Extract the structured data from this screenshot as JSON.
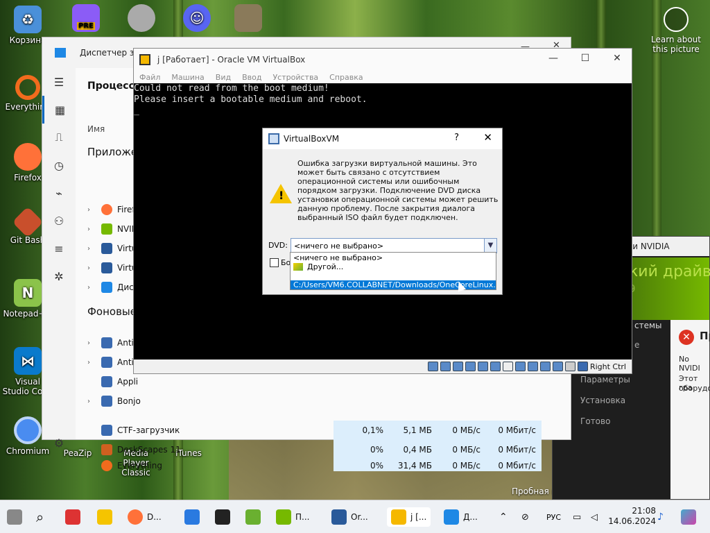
{
  "desktop_icons": [
    {
      "label": "Корзина",
      "icon": "recycle-bin-icon",
      "color": "#4a90d9"
    },
    {
      "label": "Everything",
      "icon": "everything-icon",
      "color": "#f26b1d"
    },
    {
      "label": "Firefox",
      "icon": "firefox-icon",
      "color": "#ff7139"
    },
    {
      "label": "Git Bash",
      "icon": "git-icon",
      "color": "#c94f2c"
    },
    {
      "label": "Notepad++",
      "icon": "notepadpp-icon",
      "color": "#8bc34a"
    },
    {
      "label": "Visual Studio Code",
      "icon": "vscode-icon",
      "color": "#0a7acc"
    },
    {
      "label": "Chromium",
      "icon": "chromium-icon",
      "color": "#4a8cf0"
    },
    {
      "label": "PeaZip",
      "icon": "peazip-icon",
      "color": "#6aa84f"
    },
    {
      "label": "Media Player Classic",
      "icon": "mpc-icon",
      "color": "#555555"
    },
    {
      "label": "iTunes",
      "icon": "itunes-icon",
      "color": "#e84a8a"
    },
    {
      "label": "PRE",
      "icon": "visual-studio-pre-icon",
      "color": "#8b5cf6"
    }
  ],
  "learn": {
    "label": "Learn about this picture"
  },
  "probnaya": "Пробная в",
  "task_manager": {
    "title": "Диспетчер зад",
    "heading": "Процессы",
    "col_name": "Имя",
    "section_apps": "Приложе",
    "section_bg": "Фоновые",
    "apps": [
      {
        "name": "Firef",
        "color": "#ff7139"
      },
      {
        "name": "NVID",
        "color": "#76b900"
      },
      {
        "name": "Virtu",
        "color": "#2a5a9a"
      },
      {
        "name": "Virtu",
        "color": "#2a5a9a"
      },
      {
        "name": "Дисп",
        "color": "#1e88e5"
      }
    ],
    "bg": [
      {
        "name": "Antir",
        "chev": true
      },
      {
        "name": "Antir",
        "chev": true
      },
      {
        "name": "Appli",
        "chev": false
      },
      {
        "name": "Bonjo",
        "chev": true
      }
    ],
    "rows": [
      {
        "name": "CTF-загрузчик",
        "cpu": "0,1%",
        "mem": "5,1 МБ",
        "disk": "0 МБ/с",
        "net": "0 Мбит/с"
      },
      {
        "name": "DeskScapes 11",
        "cpu": "0%",
        "mem": "0,4 МБ",
        "disk": "0 МБ/с",
        "net": "0 Мбит/с"
      },
      {
        "name": "Everything",
        "cpu": "0%",
        "mem": "31,4 МБ",
        "disk": "0 МБ/с",
        "net": "0 Мбит/с"
      }
    ]
  },
  "nvidia": {
    "title": "ки NVIDIA",
    "driver": "кий драйвер",
    "ver": "9",
    "left": [
      "стемы",
      "е",
      "Параметры",
      "Установка",
      "Готово"
    ],
    "err_title": "Пр",
    "msg1": "No NVIDI",
    "msg2": "Этот гра",
    "msg3": "оборудо"
  },
  "virtualbox": {
    "title": "j [Работает] - Oracle VM VirtualBox",
    "menu": [
      "Файл",
      "Машина",
      "Вид",
      "Ввод",
      "Устройства",
      "Справка"
    ],
    "console": [
      "Could not read from the boot medium!",
      "Please insert a bootable medium and reboot.",
      "_"
    ],
    "host_key": "Right Ctrl"
  },
  "dialog": {
    "title": "VirtualBoxVM",
    "help": "?",
    "close": "✕",
    "message": "Ошибка загрузки виртуальной машины. Это может быть связано с отсутствием операционной системы или ошибочным порядком загрузки. Подключение DVD диска установки операционной системы может решить данную проблему. После закрытия диалога выбранный ISO файл будет подключен.",
    "dvd_label": "DVD:",
    "dvd_value": "<ничего не выбрано>",
    "checkbox_label": "Бо",
    "options": [
      "<ничего не выбрано>",
      "Другой...",
      "C:/Users/VM6.COLLABNET/Downloads/OneCoreLinux.iso"
    ]
  },
  "taskbar": {
    "items": [
      {
        "label": "D...",
        "icon": "firefox-taskbar-icon",
        "color": "#ff7139"
      },
      {
        "label": "П...",
        "icon": "nvidia-taskbar-icon",
        "color": "#76b900"
      },
      {
        "label": "Or...",
        "icon": "virtualbox-taskbar-icon",
        "color": "#2a5a9a"
      },
      {
        "label": "j [...",
        "icon": "vm-taskbar-icon",
        "color": "#f5b800"
      },
      {
        "label": "Д...",
        "icon": "taskmgr-taskbar-icon",
        "color": "#1e88e5"
      }
    ],
    "lang": "РУС",
    "time": "21:08",
    "date": "14.06.2024"
  }
}
